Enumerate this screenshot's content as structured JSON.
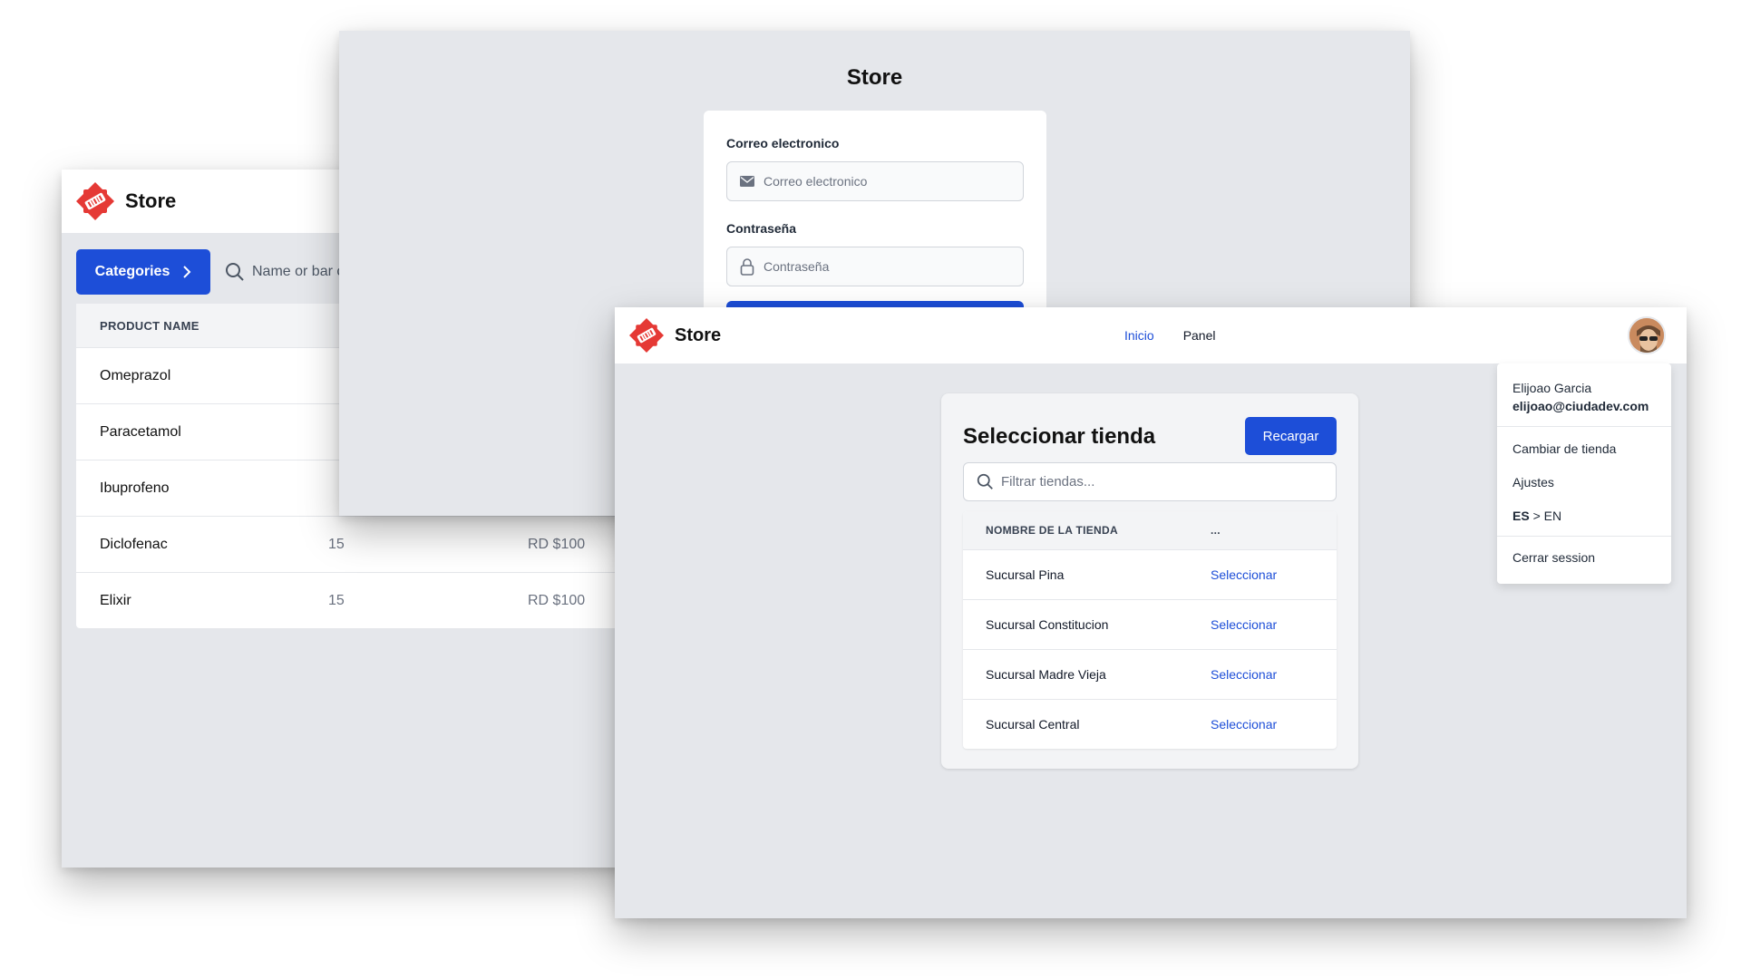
{
  "brand": {
    "name": "Store",
    "logo_color": "#e53935"
  },
  "products_window": {
    "categories_button": "Categories",
    "search_placeholder": "Name or bar c",
    "column_headers": [
      "PRODUCT NAME"
    ],
    "rows": [
      {
        "name": "Omeprazol",
        "qty": "",
        "price": ""
      },
      {
        "name": "Paracetamol",
        "qty": "",
        "price": ""
      },
      {
        "name": "Ibuprofeno",
        "qty": "",
        "price": ""
      },
      {
        "name": "Diclofenac",
        "qty": "15",
        "price": "RD $100"
      },
      {
        "name": "Elixir",
        "qty": "15",
        "price": "RD $100"
      }
    ]
  },
  "login_window": {
    "title": "Store",
    "email_label": "Correo electronico",
    "email_placeholder": "Correo electronico",
    "password_label": "Contraseña",
    "password_placeholder": "Contraseña"
  },
  "stores_window": {
    "nav": {
      "home": "Inicio",
      "panel": "Panel"
    },
    "title": "Seleccionar tienda",
    "reload_button": "Recargar",
    "filter_placeholder": "Filtrar tiendas...",
    "column_headers": {
      "name": "NOMBRE DE LA TIENDA",
      "actions": "..."
    },
    "stores": [
      {
        "name": "Sucursal Pina",
        "action": "Seleccionar"
      },
      {
        "name": "Sucursal Constitucion",
        "action": "Seleccionar"
      },
      {
        "name": "Sucursal Madre Vieja",
        "action": "Seleccionar"
      },
      {
        "name": "Sucursal Central",
        "action": "Seleccionar"
      }
    ],
    "user_menu": {
      "user_name": "Elijoao Garcia",
      "user_email": "elijoao@ciudadev.com",
      "change_store": "Cambiar de tienda",
      "settings": "Ajustes",
      "lang_current": "ES",
      "lang_separator": " > ",
      "lang_other": "EN",
      "logout": "Cerrar session"
    }
  },
  "colors": {
    "primary": "#1d4ed8",
    "background": "#e5e7eb",
    "logo_red": "#e53935"
  }
}
